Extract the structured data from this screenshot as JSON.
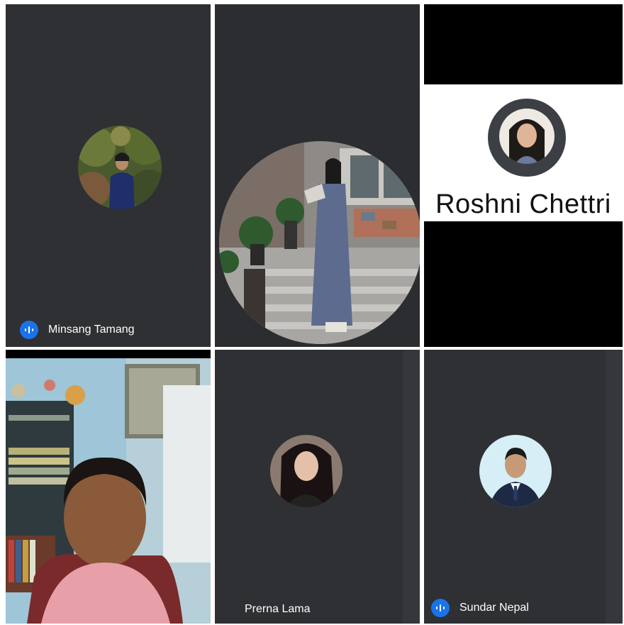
{
  "participants": [
    {
      "name": "Minsang Tamang",
      "speaking": true,
      "avatar": "girl-in-blazer-photo"
    },
    {
      "name": "",
      "speaking": false,
      "avatar": "woman-in-saree-photo"
    },
    {
      "name": "Roshni Chettri",
      "speaking": false,
      "avatar": "young-woman-portrait"
    },
    {
      "name": "",
      "speaking": false,
      "avatar": "man-webcam-video"
    },
    {
      "name": "Prerna Lama",
      "speaking": false,
      "avatar": "woman-portrait"
    },
    {
      "name": "Sundar Nepal",
      "speaking": true,
      "avatar": "man-in-suit-portrait"
    }
  ],
  "colors": {
    "tile_bg": "#2f3033",
    "speaking_indicator": "#1a73e8",
    "banner": "#ffffff"
  }
}
